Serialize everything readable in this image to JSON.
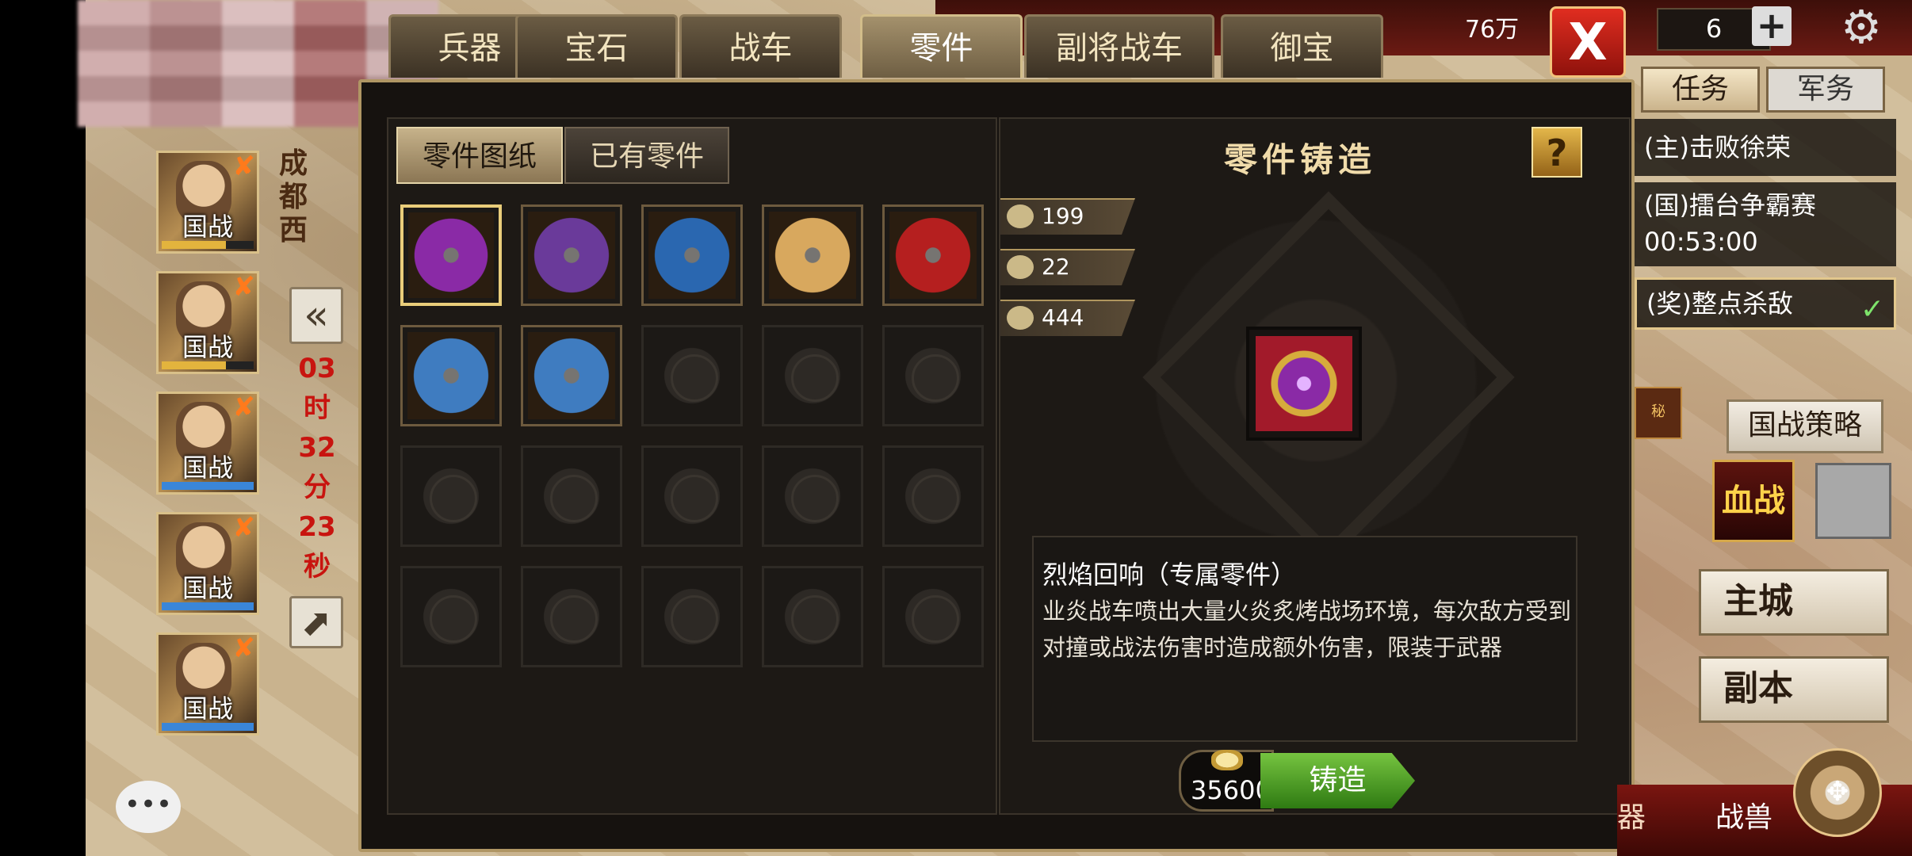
{
  "tabs": [
    "兵器",
    "宝石",
    "战车",
    "零件",
    "副将战车",
    "御宝"
  ],
  "active_tab": "零件",
  "top_bar": {
    "res_left": "76万",
    "close": "X",
    "count": "6",
    "plus": "+"
  },
  "left_panel": {
    "heroes": [
      {
        "label": "国战",
        "bar": "yellow"
      },
      {
        "label": "国战",
        "bar": "yellow"
      },
      {
        "label": "国战",
        "bar": "blue"
      },
      {
        "label": "国战",
        "bar": "blue"
      },
      {
        "label": "国战",
        "bar": "blue"
      }
    ],
    "city_name": "成都西",
    "timer": [
      "03",
      "时",
      "32",
      "分",
      "23",
      "秒"
    ]
  },
  "subtabs": {
    "blueprints": "零件图纸",
    "owned": "已有零件"
  },
  "grid": {
    "rows": 4,
    "cols": 5,
    "items": [
      {
        "name": "part-purple-swirl",
        "color": "#8a2aa6"
      },
      {
        "name": "part-mace",
        "color": "#6a3a9a"
      },
      {
        "name": "part-flag-chariot",
        "color": "#2a67b0"
      },
      {
        "name": "part-flame",
        "color": "#d8a85e"
      },
      {
        "name": "part-dragon-head",
        "color": "#b51f1f"
      },
      {
        "name": "part-armor-chariot",
        "color": "#3f7cc0"
      },
      {
        "name": "part-spiked-chariot",
        "color": "#3f7cc0"
      }
    ]
  },
  "forge": {
    "title": "零件铸造",
    "help": "?",
    "materials": [
      "199",
      "22",
      "444"
    ],
    "part_name": "烈焰回响（专属零件）",
    "part_desc": "业炎战车喷出大量火炎炙烤战场环境，每次敌方受到对撞或战法伤害时造成额外伤害，限装于武器",
    "cost": "35600",
    "button": "铸造"
  },
  "right_hud": {
    "tab_task": "任务",
    "tab_military": "军务",
    "quests": [
      "(主)击败徐荣",
      "(国)擂台争霸赛",
      "00:53:00",
      "(奖)整点杀敌"
    ],
    "strategy": "国战策略",
    "bloodwar": "血战",
    "main_city": "主城",
    "dungeon": "副本",
    "bottom_weapon": "器",
    "bottom_beast": "战兽",
    "secret": "秘"
  }
}
